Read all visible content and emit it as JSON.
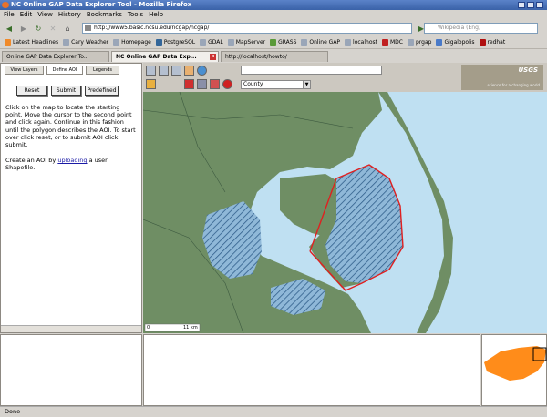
{
  "window": {
    "title": "NC Online GAP Data Explorer Tool - Mozilla Firefox"
  },
  "menu": [
    "File",
    "Edit",
    "View",
    "History",
    "Bookmarks",
    "Tools",
    "Help"
  ],
  "navigation": {
    "url": "http://www5.basic.ncsu.edu/ncgap/ncgap/",
    "search_placeholder": "Wikipedia (Eng)"
  },
  "bookmarks": [
    "Latest Headlines",
    "Cary Weather",
    "Homepage",
    "PostgreSQL",
    "GDAL",
    "MapServer",
    "GRASS",
    "Online GAP",
    "localhost",
    "MDC",
    "prgap",
    "Gigalopolis",
    "redhat"
  ],
  "tabs": [
    {
      "label": "Online GAP Data Explorer To...",
      "active": false
    },
    {
      "label": "NC Online GAP Data Exp...",
      "active": true
    },
    {
      "label": "http://localhost/howto/",
      "active": false
    }
  ],
  "left_panel": {
    "tabs": [
      "View Layers",
      "Define AOI",
      "Legends"
    ],
    "buttons": {
      "reset": "Reset",
      "submit": "Submit",
      "predefined": "Predefined"
    },
    "instructions": "Click on the map to locate the starting point. Move the cursor to the second point and click again. Continue in this fashion until the polygon describes the AOI. To start over click reset, or to submit AOI click submit.",
    "upload_prefix": "Create an AOI by",
    "upload_link": "uploading",
    "upload_suffix": "a user Shapefile."
  },
  "map_toolbar": {
    "layer_select": "County"
  },
  "branding": {
    "usgs": "USGS",
    "tagline": "science for a changing world"
  },
  "map": {
    "scalebar": "11 km",
    "scale_start": "0"
  },
  "status": {
    "text": "Done"
  },
  "colors": {
    "water": "#bfe0f2",
    "land": "#6f8e64",
    "aoi_outline": "#e02020",
    "hatch": "#2f5e8a",
    "nc_state": "#ff8c1a"
  }
}
